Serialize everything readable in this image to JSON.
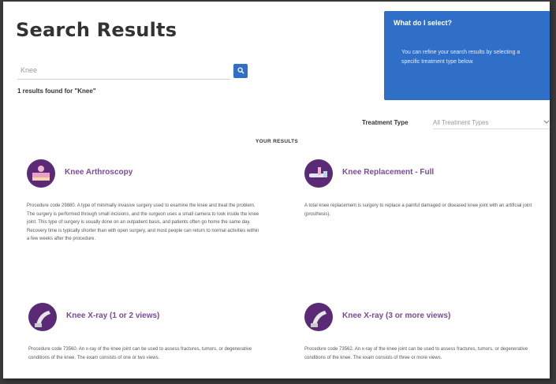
{
  "page": {
    "title": "Search Results"
  },
  "search": {
    "value": "Knee",
    "button_icon": "search-icon",
    "results_for": "1 results found for \"Knee\""
  },
  "help": {
    "title": "What do I select?",
    "text": "You can refine your search results by selecting a specific treatment type below."
  },
  "filter": {
    "label": "Treatment Type",
    "selected": "All Treatment Types",
    "chevron_icon": "chevron-down-icon"
  },
  "results": {
    "heading": "YOUR RESULTS",
    "items": [
      {
        "title": "Knee Arthroscopy",
        "icon": "knee-arthroscopy-icon",
        "description": "Procedure code 29880. A type of minimally invasive surgery used to examine the knee and treat the problem. The surgery is performed through small incisions, and the surgeon uses a small camera to look inside the knee joint. This type of surgery is usually done on an outpatient basis, and patients often go home the same day. Recovery time is typically shorter than with open surgery, and most people can return to normal activities within a few weeks after the procedure."
      },
      {
        "title": "Knee Replacement - Full",
        "icon": "knee-replacement-icon",
        "description": "A total knee replacement is surgery to replace a painful damaged or diseased knee joint with an artificial joint (prosthesis)."
      },
      {
        "title": "Knee X-ray (1 or 2 views)",
        "icon": "xray-icon",
        "description": "Procedure code 73560. An x-ray of the knee joint can be used to assess fractures, tumors, or degenerative conditions of the knee. The exam consists of one or two views."
      },
      {
        "title": "Knee X-ray (3 or more views)",
        "icon": "xray-icon",
        "description": "Procedure code 73562. An x-ray of the knee joint can be used to assess fractures, tumors, or degenerative conditions of the knee. The exam consists of three or more views."
      }
    ]
  },
  "colors": {
    "accent": "#2f6fc8",
    "icon_bg": "#5a2a76",
    "card_title": "#7a4a9a"
  }
}
